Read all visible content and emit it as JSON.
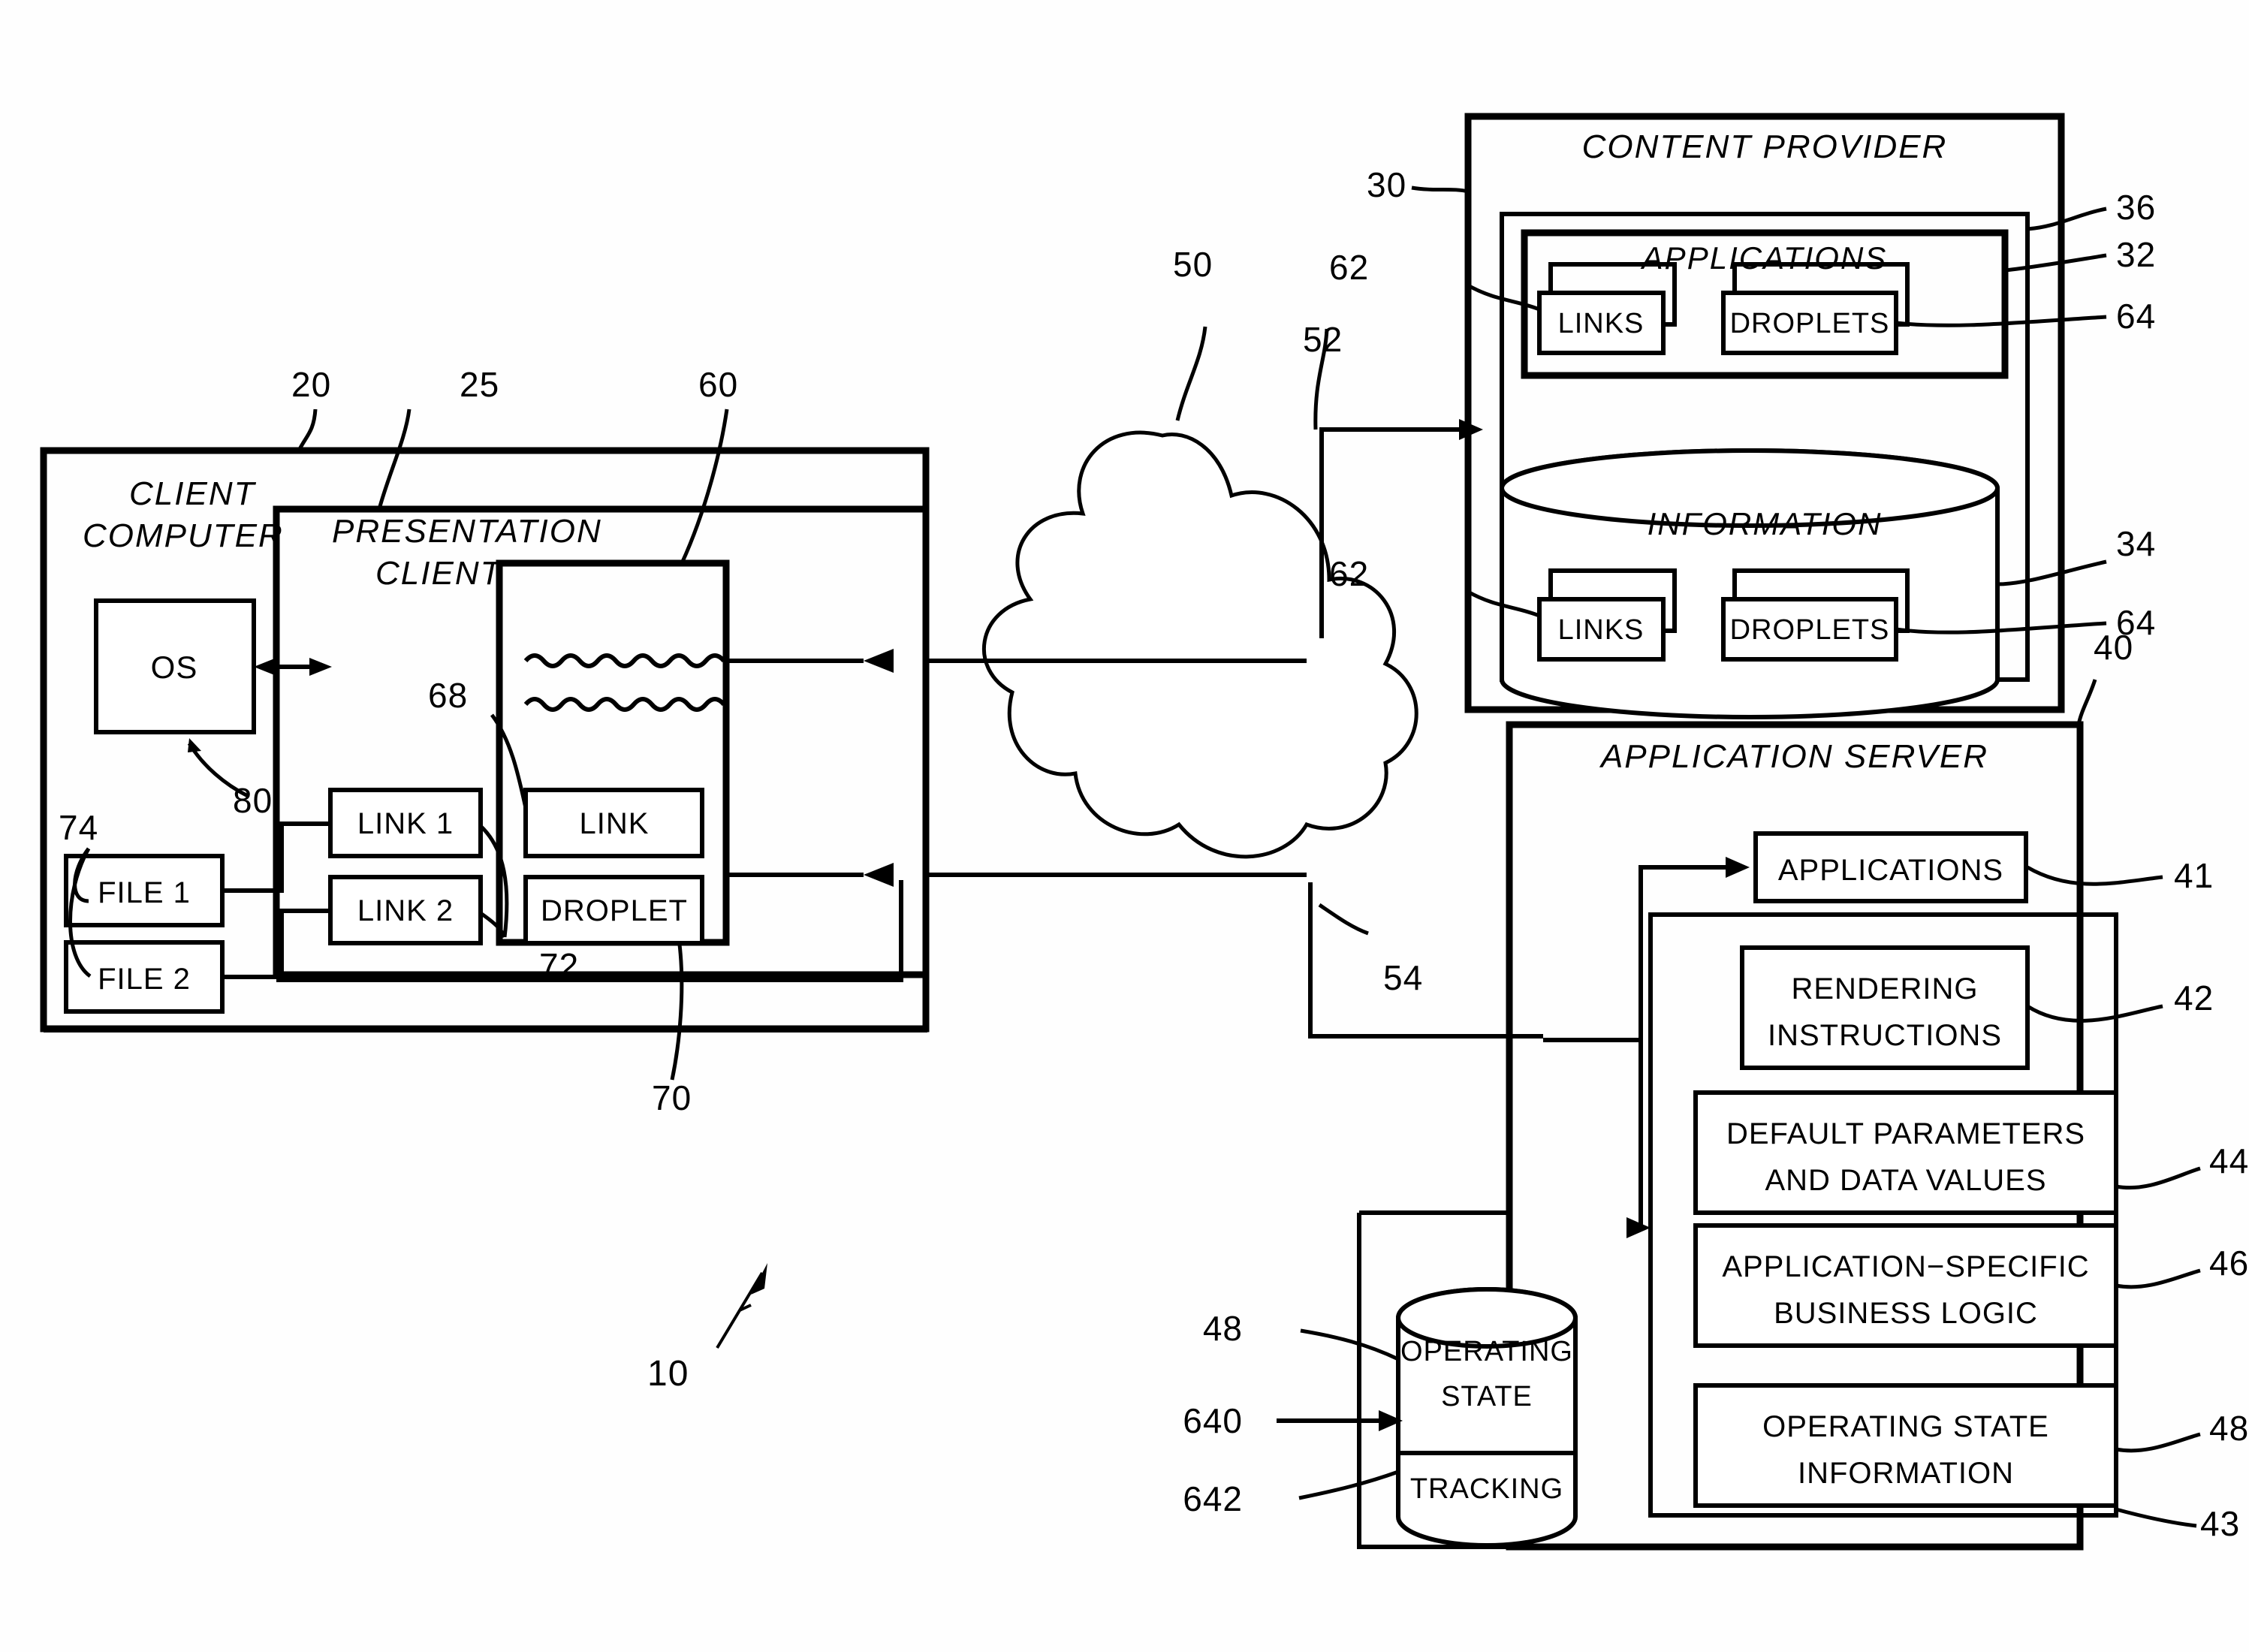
{
  "figure": {
    "title_ref": "10",
    "type": "patent-block-diagram"
  },
  "client": {
    "box_label": "CLIENT COMPUTER",
    "box_ref": "20",
    "os_label": "OS",
    "os_ref": "80",
    "files_ref": "74",
    "files": [
      "FILE 1",
      "FILE 2"
    ]
  },
  "presentation_client": {
    "box_label": "PRESENTATION CLIENT",
    "box_ref": "25",
    "links": [
      "LINK 1",
      "LINK 2"
    ],
    "links_ref": "72",
    "window_ref": "60",
    "window_link_label": "LINK",
    "window_link_ref": "68",
    "window_droplet_label": "DROPLET",
    "window_droplet_ref": "70"
  },
  "network": {
    "cloud_ref": "50",
    "link_up_ref": "52",
    "link_down_ref": "54"
  },
  "content_provider": {
    "box_label": "CONTENT PROVIDER",
    "box_ref": "30",
    "applications": {
      "label": "APPLICATIONS",
      "outer_ref": "36",
      "inner_ref": "32",
      "links_label": "LINKS",
      "links_ref": "62",
      "droplets_label": "DROPLETS",
      "droplets_ref": "64"
    },
    "information": {
      "label": "INFORMATION",
      "ref": "34",
      "links_label": "LINKS",
      "links_ref": "62",
      "droplets_label": "DROPLETS",
      "droplets_ref": "64"
    }
  },
  "application_server": {
    "box_label": "APPLICATION SERVER",
    "box_ref": "40",
    "applications_label": "APPLICATIONS",
    "applications_ref": "41",
    "inner_box_ref": "43",
    "items": [
      {
        "label_line1": "RENDERING",
        "label_line2": "INSTRUCTIONS",
        "ref": "42"
      },
      {
        "label_line1": "DEFAULT PARAMETERS",
        "label_line2": "AND DATA VALUES",
        "ref": "44"
      },
      {
        "label_line1": "APPLICATION−SPECIFIC",
        "label_line2": "BUSINESS LOGIC",
        "ref": "46"
      },
      {
        "label_line1": "OPERATING STATE",
        "label_line2": "INFORMATION",
        "ref": "48"
      }
    ],
    "store": {
      "line1": "OPERATING",
      "line2": "STATE",
      "line3": "TRACKING",
      "state_ref": "48",
      "in_ref": "640",
      "tracking_ref": "642"
    }
  },
  "colors": {
    "ink": "#000000",
    "paper": "#ffffff"
  }
}
